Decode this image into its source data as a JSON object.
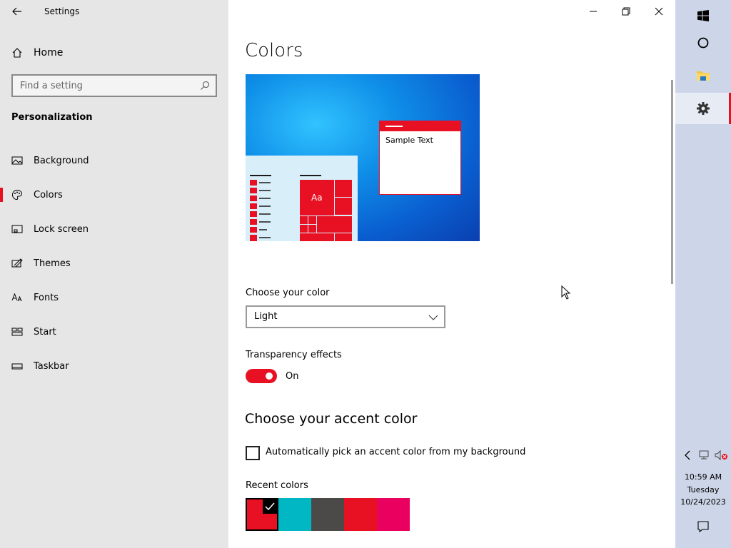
{
  "window": {
    "title": "Settings"
  },
  "sidebar": {
    "home_label": "Home",
    "search_placeholder": "Find a setting",
    "section": "Personalization",
    "items": [
      {
        "label": "Background",
        "icon": "image-icon"
      },
      {
        "label": "Colors",
        "icon": "palette-icon",
        "selected": true
      },
      {
        "label": "Lock screen",
        "icon": "lock-screen-icon"
      },
      {
        "label": "Themes",
        "icon": "themes-icon"
      },
      {
        "label": "Fonts",
        "icon": "fonts-icon"
      },
      {
        "label": "Start",
        "icon": "start-icon"
      },
      {
        "label": "Taskbar",
        "icon": "taskbar-icon"
      }
    ]
  },
  "main": {
    "title": "Colors",
    "preview": {
      "sample_text": "Sample Text",
      "tile_label": "Aa"
    },
    "choose_color": {
      "label": "Choose your color",
      "value": "Light"
    },
    "transparency": {
      "label": "Transparency effects",
      "state": "On"
    },
    "accent": {
      "heading": "Choose your accent color",
      "auto_pick_label": "Automatically pick an accent color from my background",
      "recent_label": "Recent colors",
      "recent_colors": [
        "#e81123",
        "#00b7c3",
        "#4c4a48",
        "#e81123",
        "#ea005e"
      ]
    }
  },
  "colors": {
    "accent": "#e81123",
    "sidebar_bg": "#e6e6e6",
    "taskbar_bg": "#cdd6e8"
  },
  "taskbar": {
    "clock": {
      "time": "10:59 AM",
      "day": "Tuesday",
      "date": "10/24/2023"
    }
  }
}
